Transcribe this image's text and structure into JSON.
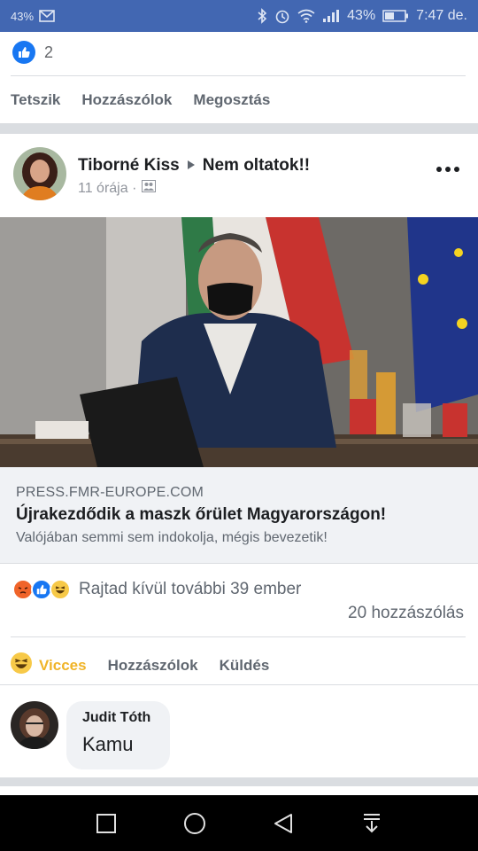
{
  "status_bar": {
    "battery_left": "43%",
    "battery_right": "43%",
    "time": "7:47 de."
  },
  "prev_post": {
    "like_count": "2",
    "actions": [
      "Tetszik",
      "Hozzászólok",
      "Megosztás"
    ]
  },
  "post": {
    "author": "Tiborné Kiss",
    "target_group": "Nem oltatok!!",
    "time_ago": "11 órája ·",
    "link": {
      "domain": "PRESS.FMR-EUROPE.COM",
      "title": "Újrakezdődik a maszk őrület Magyarországon!",
      "description": "Valójában semmi sem indokolja, mégis bevezetik!"
    },
    "reactions_text": "Rajtad kívül további 39 ember",
    "comment_count": "20 hozzászólás",
    "actions": {
      "reaction": "Vicces",
      "comment": "Hozzászólok",
      "send": "Küldés"
    },
    "comment": {
      "author": "Judit Tóth",
      "text": "Kamu"
    }
  },
  "colors": {
    "status_bar": "#4267b2",
    "like_blue": "#1877f2",
    "vicces_yellow": "#f0b429"
  }
}
